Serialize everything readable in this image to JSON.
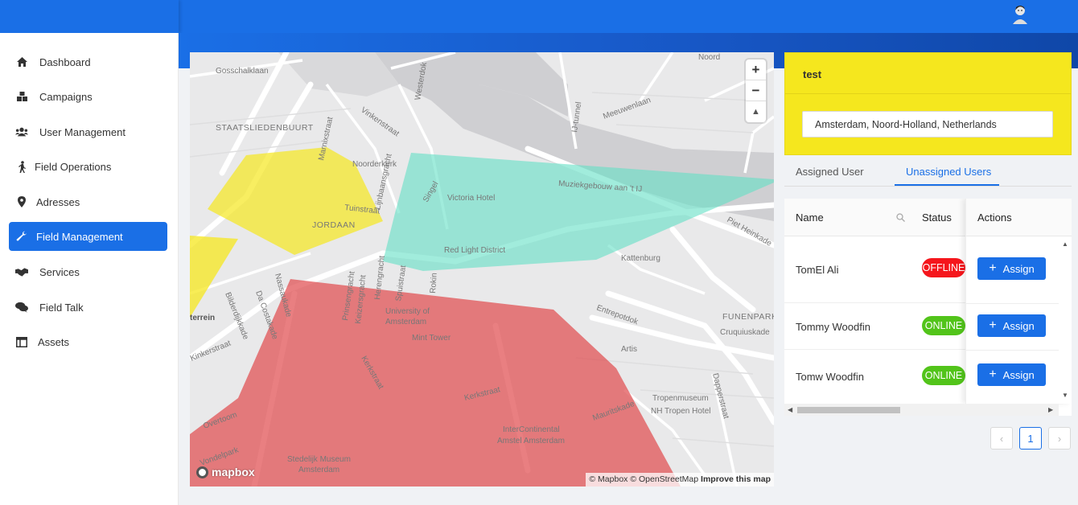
{
  "nav": [
    {
      "label": "Dashboard",
      "icon": "home-icon"
    },
    {
      "label": "Campaigns",
      "icon": "boxes-icon"
    },
    {
      "label": "User Management",
      "icon": "users-icon"
    },
    {
      "label": "Field Operations",
      "icon": "walking-icon"
    },
    {
      "label": "Adresses",
      "icon": "map-pin-icon"
    },
    {
      "label": "Field Management",
      "icon": "wrench-icon"
    },
    {
      "label": "Services",
      "icon": "handshake-icon"
    },
    {
      "label": "Field Talk",
      "icon": "comments-icon"
    },
    {
      "label": "Assets",
      "icon": "table-icon"
    }
  ],
  "active_nav": "Field Management",
  "map": {
    "labels": {
      "staatsliedenbuurt": "STAATSLIEDENBUURT",
      "jordaan": "JORDAAN",
      "funenpark": "FUNENPARK",
      "gosschalklaan": "Gosschalklaan",
      "noorderkerk": "Noorderkerk",
      "victoria": "Victoria Hotel",
      "redlight": "Red Light District",
      "kattenburg": "Kattenburg",
      "muziekgebouw": "Muziekgebouw aan 't IJ",
      "piet": "Piet Heinkade",
      "entrepotdok": "Entrepotdok",
      "artis": "Artis",
      "cruquius": "Cruquiuskade",
      "tropenmuseum": "Tropenmuseum",
      "tropenhotel": "NH Tropen Hotel",
      "university": "University of",
      "university2": "Amsterdam",
      "mint": "Mint Tower",
      "kerkstraat": "Kerkstraat",
      "kerkstraat2": "Kerkstraat",
      "intercont": "InterContinental",
      "intercont2": "Amstel Amsterdam",
      "stedelijk": "Stedelijk Museum",
      "stedelijk2": "Amsterdam",
      "overtoom": "Overtoom",
      "kinkerstraat": "Kinkerstraat",
      "noord": "Noord",
      "ijtunnel": "IJ-tunnel",
      "meeuwenlaan": "Meeuwenlaan",
      "westerdok": "Westerdok",
      "vinkenstraat": "Vinkenstraat",
      "marnixstraat": "Marnixstraat",
      "tuinstraat": "Tuinstraat",
      "terrein": "terrein",
      "bilderdijk": "Bilderdijkkade",
      "mauritskade": "Mauritskade",
      "vondelpark": "Vondelpark",
      "prinsengracht": "Prinsengracht",
      "keizersgracht": "Keizersgracht",
      "herengracht": "Herengracht",
      "spuistraat": "Spuistraat",
      "singel": "Singel",
      "nassaukade": "Nassaukade",
      "dacostakade": "Da Costakade",
      "rokin": "Rokin",
      "lijnbaansgracht": "Lijnbaansgracht",
      "dapperstraat": "Dapperstraat"
    },
    "attribution": "© Mapbox © OpenStreetMap",
    "improve": "Improve this map",
    "logo": "mapbox",
    "zoom_in": "+",
    "zoom_out": "−",
    "compass": "▲"
  },
  "zone": {
    "title": "test",
    "address": "Amsterdam, Noord-Holland, Netherlands"
  },
  "tabs": {
    "assigned": "Assigned User",
    "unassigned": "Unassigned Users"
  },
  "table": {
    "headers": {
      "name": "Name",
      "status": "Status",
      "actions": "Actions"
    },
    "rows": [
      {
        "name": "TomEl Ali",
        "status": "OFFLINE",
        "action": "Assign"
      },
      {
        "name": "Tommy Woodfin",
        "status": "ONLINE",
        "action": "Assign"
      },
      {
        "name": "Tomw Woodfin",
        "status": "ONLINE",
        "action": "Assign"
      }
    ]
  },
  "pagination": {
    "prev": "‹",
    "current": "1",
    "next": "›"
  },
  "colors": {
    "primary": "#1a6fe6",
    "zone_yellow": "#f5e71e",
    "offline": "#f5161c",
    "online": "#52c41a"
  }
}
